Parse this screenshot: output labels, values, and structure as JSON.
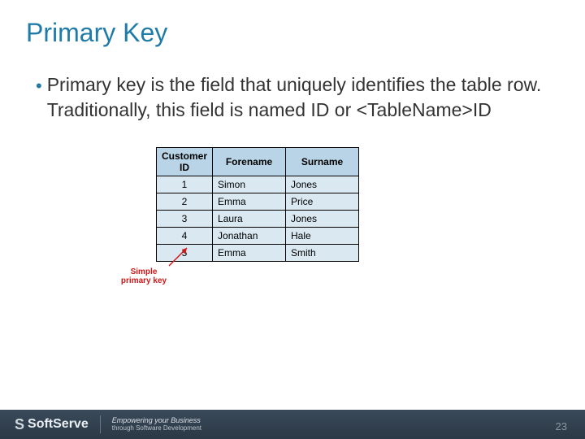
{
  "title": "Primary Key",
  "bullet_text": "Primary key is the field that uniquely identifies the table row. Traditionally, this field is named ID or <TableName>ID",
  "table": {
    "headers": [
      "Customer ID",
      "Forename",
      "Surname"
    ],
    "rows": [
      [
        "1",
        "Simon",
        "Jones"
      ],
      [
        "2",
        "Emma",
        "Price"
      ],
      [
        "3",
        "Laura",
        "Jones"
      ],
      [
        "4",
        "Jonathan",
        "Hale"
      ],
      [
        "5",
        "Emma",
        "Smith"
      ]
    ]
  },
  "annotation": "Simple primary key",
  "footer": {
    "brand": "SoftServe",
    "tagline1": "Empowering your Business",
    "tagline2": "through Software Development"
  },
  "page_number": "23"
}
